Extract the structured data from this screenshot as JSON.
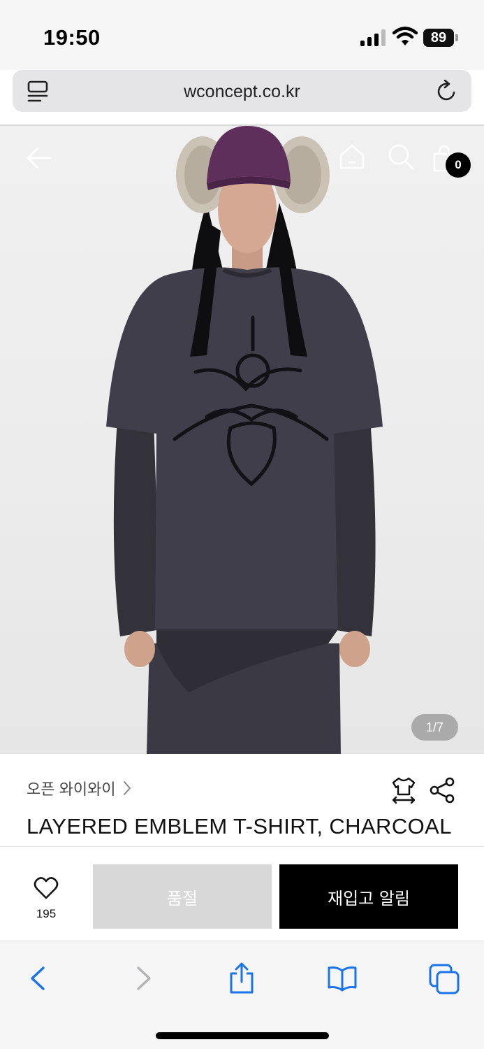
{
  "status_bar": {
    "time": "19:50",
    "battery": "89"
  },
  "address_bar": {
    "url": "wconcept.co.kr"
  },
  "header_nav": {
    "cart_count": "0"
  },
  "gallery": {
    "counter": "1/7"
  },
  "product": {
    "brand": "오픈 와이와이",
    "title": "LAYERED EMBLEM T-SHIRT, CHARCOAL"
  },
  "actions": {
    "wish_count": "195",
    "soldout_label": "품절",
    "restock_label": "재입고 알림"
  },
  "colors": {
    "accent_blue": "#1a73e8",
    "sweatshirt": "#3f3e4a",
    "cap": "#5e2f5a"
  },
  "icons": {
    "header": [
      "back-arrow-icon",
      "home-icon",
      "search-icon",
      "shopping-bag-icon"
    ],
    "toolbar": [
      "chevron-left-icon",
      "chevron-right-icon",
      "share-icon",
      "bookmarks-icon",
      "tabs-icon"
    ]
  }
}
